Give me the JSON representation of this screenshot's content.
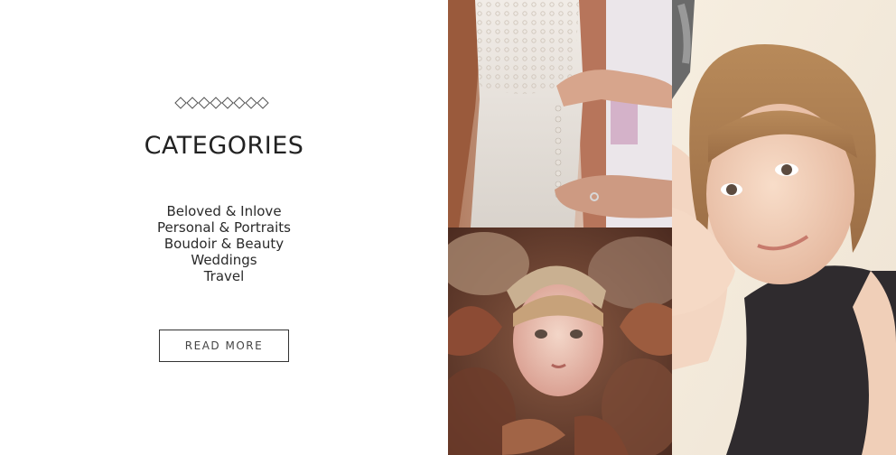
{
  "intro": {
    "title": "CATEGORIES",
    "categories": [
      "Beloved & Inlove",
      "Personal & Portraits",
      "Boudoir & Beauty",
      "Weddings",
      "Travel"
    ],
    "cta_label": "READ MORE"
  },
  "gallery": [
    {
      "subject": "bride-dress-lacing-photo"
    },
    {
      "subject": "child-in-autumn-leaves-photo"
    },
    {
      "subject": "smiling-girl-portrait-photo"
    }
  ],
  "colors": {
    "text": "#222222",
    "button_border": "#333333",
    "diamond_stroke": "#555555"
  }
}
